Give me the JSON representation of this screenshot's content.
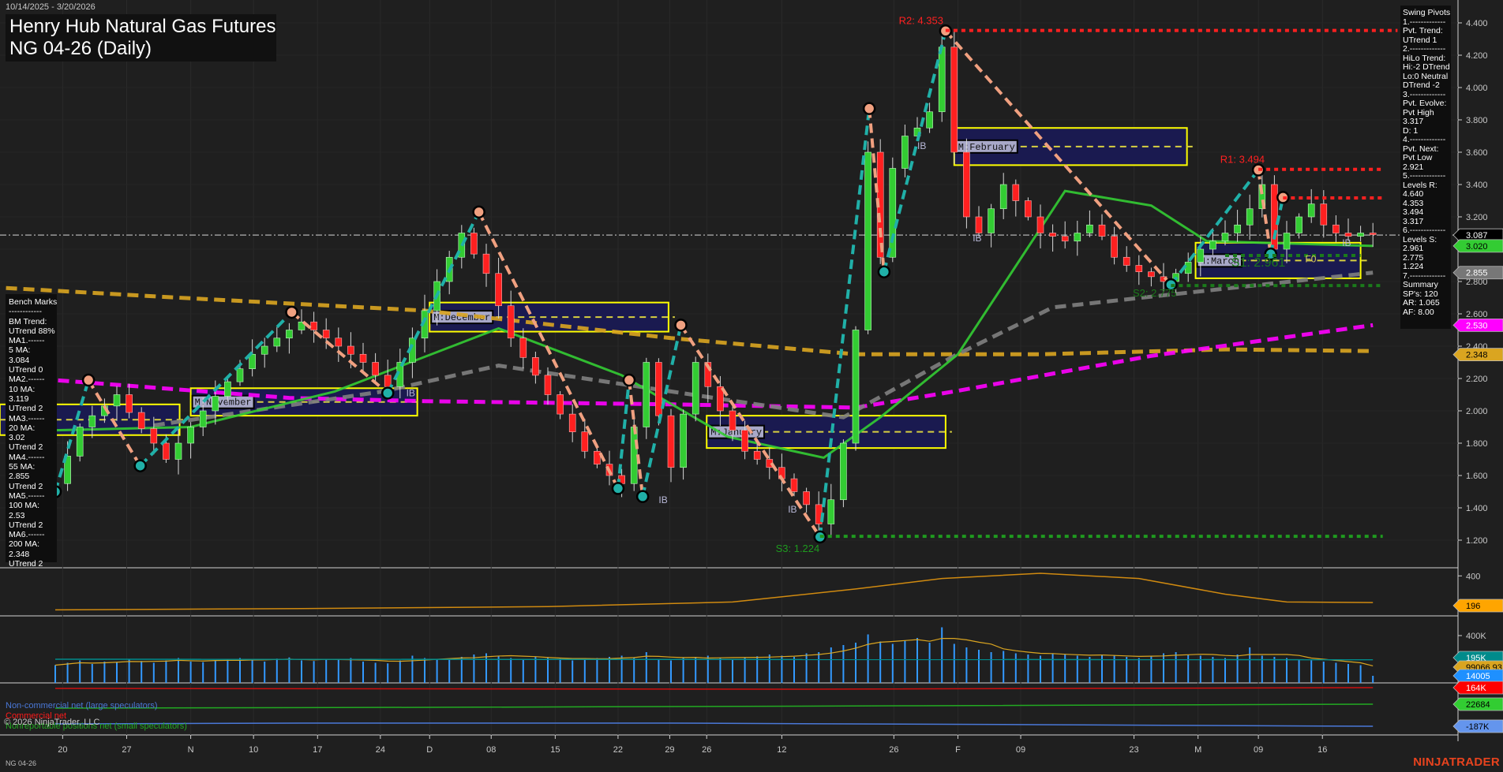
{
  "header": {
    "date_range": "10/14/2025 - 3/20/2026",
    "title_line1": "Henry Hub Natural Gas Futures",
    "title_line2": "NG 04-26 (Daily)"
  },
  "bench_marks": [
    "Bench Marks",
    "------------",
    "BM Trend:",
    "UTrend 88%",
    "MA1.------",
    "5 MA:",
    "3.084",
    "UTrend 0",
    "MA2.------",
    "10 MA:",
    "3.119",
    "UTrend 2",
    "MA3.------",
    "20 MA:",
    "3.02",
    "UTrend 2",
    "MA4.------",
    "55 MA:",
    "2.855",
    "UTrend 2",
    "MA5.------",
    "100 MA:",
    "2.53",
    "UTrend 2",
    "MA6.------",
    "200 MA:",
    "2.348",
    "UTrend 2"
  ],
  "swing_pivots": [
    "Swing Pivots",
    "1.-------------",
    "Pvt. Trend:",
    "UTrend 1",
    "2.-------------",
    "HiLo Trend:",
    "Hi:-2 DTrend",
    "Lo:0 Neutral",
    "DTrend -2",
    "3.-------------",
    "Pvt. Evolve:",
    "Pvt High",
    "3.317",
    "D: 1",
    "4.-------------",
    "Pvt. Next:",
    "Pvt Low",
    "2.921",
    "5.-------------",
    "Levels R:",
    "4.640",
    "4.353",
    "3.494",
    "3.317",
    "6.-------------",
    "Levels S:",
    "2.961",
    "2.775",
    "1.224",
    "7.-------------",
    "Summary",
    "SP's: 120",
    "AR: 1.065",
    "AF: 8.00"
  ],
  "legend": {
    "noncommercial": "Non-commercial net (large speculators)",
    "commercial": "Commercial net",
    "copyright": "© 2026 NinjaTrader, LLC",
    "nonreportable": "Nonreportable positions net (small speculators)"
  },
  "footer": {
    "symbol": "NG 04-26",
    "brand": "NINJATRADER"
  },
  "colors": {
    "background": "#1f1f1f",
    "up": "#33cc33",
    "down": "#ff2020",
    "swing_down": "#f0a080",
    "swing_up": "#20b0a8",
    "ma20": "#33cc33",
    "ma55": "#808080",
    "ma100": "#ff00ff",
    "ma200": "#daa520",
    "box_fill": "#1a1a55",
    "box_border": "#ffff00"
  },
  "chart_data": {
    "type": "candlestick",
    "title": "Henry Hub Natural Gas Futures NG 04-26 (Daily)",
    "ylim": [
      1.1,
      4.5
    ],
    "y_ticks": [
      "4.400",
      "4.200",
      "4.000",
      "3.800",
      "3.600",
      "3.400",
      "3.200",
      "3.000",
      "2.800",
      "2.600",
      "2.400",
      "2.200",
      "2.000",
      "1.800",
      "1.600",
      "1.400",
      "1.200"
    ],
    "x_ticks": [
      {
        "label": "20",
        "i": 0.6
      },
      {
        "label": "27",
        "i": 5.8
      },
      {
        "label": "N",
        "i": 11
      },
      {
        "label": "10",
        "i": 16.1
      },
      {
        "label": "17",
        "i": 21.3
      },
      {
        "label": "24",
        "i": 26.4
      },
      {
        "label": "D",
        "i": 30.4
      },
      {
        "label": "08",
        "i": 35.4
      },
      {
        "label": "15",
        "i": 40.6
      },
      {
        "label": "22",
        "i": 45.7
      },
      {
        "label": "29",
        "i": 49.9
      },
      {
        "label": "26",
        "i": 52.9
      },
      {
        "label": "12",
        "i": 59
      },
      {
        "label": "26",
        "i": 68.1
      },
      {
        "label": "F",
        "i": 73.3
      },
      {
        "label": "09",
        "i": 78.4
      },
      {
        "label": "23",
        "i": 87.6
      },
      {
        "label": "M",
        "i": 92.8
      },
      {
        "label": "09",
        "i": 97.7
      },
      {
        "label": "16",
        "i": 102.9
      }
    ],
    "closes": [
      1.55,
      1.72,
      1.9,
      1.97,
      2.03,
      2.1,
      1.99,
      1.89,
      1.8,
      1.7,
      1.8,
      1.9,
      2.0,
      2.09,
      2.18,
      2.26,
      2.35,
      2.4,
      2.45,
      2.5,
      2.55,
      2.5,
      2.45,
      2.4,
      2.35,
      2.3,
      2.22,
      2.15,
      2.3,
      2.45,
      2.62,
      2.8,
      2.95,
      3.1,
      2.97,
      2.85,
      2.65,
      2.45,
      2.33,
      2.22,
      2.1,
      1.98,
      1.87,
      1.75,
      1.67,
      1.6,
      1.55,
      1.9,
      2.3,
      1.97,
      1.65,
      1.98,
      2.3,
      2.15,
      2.0,
      1.88,
      1.75,
      1.7,
      1.65,
      1.58,
      1.5,
      1.42,
      1.3,
      1.45,
      1.8,
      2.5,
      3.6,
      2.95,
      3.5,
      3.7,
      3.75,
      3.85,
      4.25,
      3.6,
      3.2,
      3.1,
      3.25,
      3.4,
      3.3,
      3.2,
      3.1,
      3.08,
      3.05,
      3.1,
      3.15,
      3.08,
      2.95,
      2.9,
      2.86,
      2.83,
      2.8,
      2.85,
      2.92,
      3.0,
      3.05,
      3.1,
      3.15,
      3.25,
      3.4,
      3.0,
      3.1,
      3.2,
      3.28,
      3.15,
      3.1,
      3.08,
      3.1,
      3.09
    ],
    "last_price": 3.087,
    "moving_averages": [
      {
        "name": "200 MA",
        "value": "2.348",
        "color": "#daa520",
        "dash": true,
        "points": [
          [
            -4,
            2.76
          ],
          [
            10,
            2.7
          ],
          [
            30,
            2.62
          ],
          [
            50,
            2.45
          ],
          [
            65,
            2.35
          ],
          [
            80,
            2.35
          ],
          [
            95,
            2.38
          ],
          [
            107,
            2.37
          ]
        ]
      },
      {
        "name": "100 MA",
        "value": "2.530",
        "color": "#ff00ff",
        "dash": true,
        "points": [
          [
            -4,
            2.2
          ],
          [
            0,
            2.19
          ],
          [
            19,
            2.08
          ],
          [
            30,
            2.06
          ],
          [
            50,
            2.04
          ],
          [
            65,
            2.02
          ],
          [
            73,
            2.12
          ],
          [
            89,
            2.34
          ],
          [
            107,
            2.53
          ]
        ]
      },
      {
        "name": "55 MA",
        "value": "2.855",
        "color": "#808080",
        "dash": true,
        "points": [
          [
            8,
            1.91
          ],
          [
            26.6,
            2.12
          ],
          [
            36,
            2.28
          ],
          [
            50,
            2.12
          ],
          [
            64,
            1.96
          ],
          [
            73,
            2.34
          ],
          [
            81,
            2.64
          ],
          [
            96.7,
            2.77
          ],
          [
            107,
            2.855
          ]
        ]
      },
      {
        "name": "20 MA",
        "value": "3.020",
        "color": "#33cc33",
        "dash": false,
        "points": [
          [
            0,
            1.88
          ],
          [
            11,
            1.9
          ],
          [
            22.7,
            2.12
          ],
          [
            36,
            2.51
          ],
          [
            46,
            2.22
          ],
          [
            54.6,
            1.84
          ],
          [
            62.4,
            1.71
          ],
          [
            67,
            1.96
          ],
          [
            73.3,
            2.35
          ],
          [
            82,
            3.36
          ],
          [
            89,
            3.27
          ],
          [
            93.5,
            3.05
          ],
          [
            107,
            3.02
          ]
        ]
      }
    ],
    "swing_pivots": [
      [
        0,
        1.5,
        "L"
      ],
      [
        2.7,
        2.19,
        "H"
      ],
      [
        6.9,
        1.66,
        "L"
      ],
      [
        19.2,
        2.61,
        "H"
      ],
      [
        27,
        2.11,
        "L"
      ],
      [
        34.4,
        3.23,
        "H"
      ],
      [
        45.7,
        1.52,
        "L"
      ],
      [
        46.6,
        2.19,
        "H"
      ],
      [
        47.7,
        1.47,
        "L"
      ],
      [
        50.8,
        2.53,
        "H"
      ],
      [
        62.1,
        1.22,
        "L"
      ],
      [
        66.1,
        3.87,
        "H"
      ],
      [
        67.3,
        2.86,
        "L"
      ],
      [
        72.3,
        4.35,
        "H"
      ],
      [
        90.6,
        2.78,
        "L"
      ],
      [
        97.7,
        3.49,
        "H"
      ],
      [
        98.7,
        2.97,
        "L"
      ],
      [
        99.7,
        3.32,
        "H"
      ]
    ],
    "monthly_boxes": [
      {
        "label": "",
        "i0": -4.5,
        "i1": 10.1,
        "hi": 2.04,
        "lo": 1.85
      },
      {
        "label": "M:November",
        "i0": 11,
        "i1": 29.4,
        "hi": 2.14,
        "lo": 1.97
      },
      {
        "label": "M:December",
        "i0": 30.4,
        "i1": 49.8,
        "hi": 2.67,
        "lo": 2.49
      },
      {
        "label": "M:January",
        "i0": 52.9,
        "i1": 72.3,
        "hi": 1.97,
        "lo": 1.77
      },
      {
        "label": "M:February",
        "i0": 73,
        "i1": 91.9,
        "hi": 3.75,
        "lo": 3.52
      },
      {
        "label": "M:March",
        "i0": 92.6,
        "i1": 106,
        "hi": 3.04,
        "lo": 2.82
      }
    ],
    "levels": [
      {
        "label": "R2: 4.353",
        "value": 4.353,
        "i0": 72.3,
        "i1": 109,
        "color": "#ff2020",
        "label_i": 68.5
      },
      {
        "label": "R1: 3.494",
        "value": 3.494,
        "i0": 97.7,
        "i1": 107.8,
        "color": "#ff2020",
        "label_i": 94.6
      },
      {
        "label": "",
        "value": 3.317,
        "i0": 99.7,
        "i1": 107.8,
        "color": "#ff2020",
        "label_i": 0
      },
      {
        "label": "S2: 2.775",
        "value": 2.775,
        "i0": 90.6,
        "i1": 107.8,
        "color": "#1b7a1b",
        "label_i": 87.5
      },
      {
        "label": "S1: 2.961",
        "value": 2.961,
        "i0": 95,
        "i1": 106,
        "color": "#1b7a1b",
        "label_i": 95.5
      },
      {
        "label": "S3: 1.224",
        "value": 1.224,
        "i0": 62.1,
        "i1": 107.8,
        "color": "#1f9a1f",
        "label_i": 58.5
      }
    ],
    "annotations": [
      {
        "text": "IB",
        "i": 28.5,
        "p": 2.09
      },
      {
        "text": "IB",
        "i": 49,
        "p": 1.43
      },
      {
        "text": "IB",
        "i": 59.5,
        "p": 1.37
      },
      {
        "text": "IB",
        "i": 70,
        "p": 3.62
      },
      {
        "text": "IB",
        "i": 74.5,
        "p": 3.05
      },
      {
        "text": "IB",
        "i": 104.5,
        "p": 3.02
      },
      {
        "text": "F0",
        "i": 101.5,
        "p": 2.92
      }
    ],
    "indicator": {
      "axis_label": "400",
      "value": "196",
      "ylim": [
        100,
        450
      ],
      "points": [
        [
          0,
          140
        ],
        [
          20,
          150
        ],
        [
          40,
          165
        ],
        [
          55,
          200
        ],
        [
          65,
          300
        ],
        [
          72,
          380
        ],
        [
          80,
          420
        ],
        [
          88,
          380
        ],
        [
          95,
          260
        ],
        [
          100,
          200
        ],
        [
          107,
          196
        ]
      ]
    },
    "volume": {
      "axis_label": "400K",
      "ylim_k": [
        0,
        500
      ],
      "oi_label": "195K",
      "avg_label": "99066.93",
      "vol_label": "14005",
      "values_k": [
        150,
        170,
        190,
        160,
        180,
        175,
        200,
        185,
        170,
        190,
        210,
        180,
        175,
        190,
        200,
        210,
        195,
        180,
        205,
        215,
        190,
        185,
        200,
        195,
        210,
        180,
        170,
        165,
        190,
        230,
        210,
        200,
        195,
        220,
        240,
        250,
        230,
        210,
        200,
        220,
        215,
        205,
        190,
        200,
        210,
        220,
        230,
        210,
        260,
        200,
        190,
        210,
        220,
        230,
        210,
        200,
        215,
        225,
        240,
        230,
        220,
        250,
        260,
        300,
        320,
        340,
        410,
        350,
        330,
        360,
        380,
        340,
        470,
        330,
        300,
        280,
        260,
        270,
        250,
        240,
        230,
        250,
        240,
        230,
        220,
        240,
        230,
        220,
        210,
        230,
        250,
        260,
        240,
        230,
        220,
        210,
        240,
        300,
        230,
        220,
        210,
        200,
        190,
        180,
        170,
        160,
        150,
        60
      ]
    },
    "cot": {
      "commercial_label": "164K",
      "nonreportable_label": "22684",
      "noncommercial_label": "-187K"
    },
    "badges": [
      {
        "text": "3.087",
        "value": 3.087,
        "bg": "#000000",
        "fg": "#ffffff"
      },
      {
        "text": "3.020",
        "value": 3.02,
        "bg": "#33cc33",
        "fg": "#000000"
      },
      {
        "text": "2.855",
        "value": 2.855,
        "bg": "#777777",
        "fg": "#ffffff"
      },
      {
        "text": "2.530",
        "value": 2.53,
        "bg": "#ff00ff",
        "fg": "#ffffff"
      },
      {
        "text": "2.348",
        "value": 2.348,
        "bg": "#daa520",
        "fg": "#000000"
      }
    ]
  }
}
